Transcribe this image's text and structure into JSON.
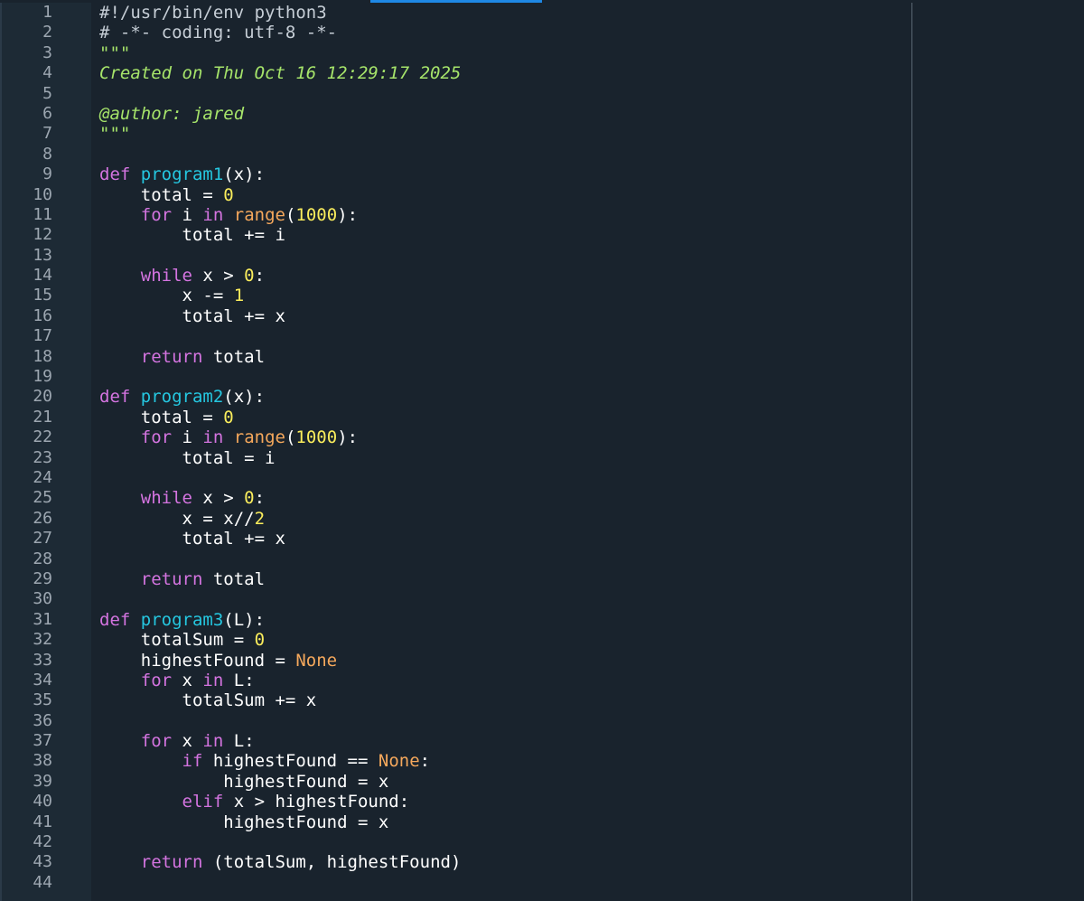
{
  "colors": {
    "background": "#19232d",
    "gutter_background": "#1d2a35",
    "line_number": "#9da7b1",
    "accent_tab": "#1e88e5",
    "ruler": "#5a6773",
    "comment": "#c6ced6",
    "docstring": "#a6e46a",
    "keyword": "#d474e0",
    "function_name": "#25c7e0",
    "number": "#faed5c",
    "builtin": "#f5a85c",
    "plain": "#ffffff"
  },
  "line_numbers": [
    "1",
    "2",
    "3",
    "4",
    "5",
    "6",
    "7",
    "8",
    "9",
    "10",
    "11",
    "12",
    "13",
    "14",
    "15",
    "16",
    "17",
    "18",
    "19",
    "20",
    "21",
    "22",
    "23",
    "24",
    "25",
    "26",
    "27",
    "28",
    "29",
    "30",
    "31",
    "32",
    "33",
    "34",
    "35",
    "36",
    "37",
    "38",
    "39",
    "40",
    "41",
    "42",
    "43",
    "44"
  ],
  "code_lines": [
    [
      {
        "t": "comment",
        "s": "#!/usr/bin/env python3"
      }
    ],
    [
      {
        "t": "comment",
        "s": "# -*- coding: utf-8 -*-"
      }
    ],
    [
      {
        "t": "doc",
        "s": "\"\"\""
      }
    ],
    [
      {
        "t": "doc",
        "s": "Created on Thu Oct 16 12:29:17 2025"
      }
    ],
    [],
    [
      {
        "t": "doc",
        "s": "@author: jared"
      }
    ],
    [
      {
        "t": "doc",
        "s": "\"\"\""
      }
    ],
    [],
    [
      {
        "t": "keyword",
        "s": "def "
      },
      {
        "t": "funcname",
        "s": "program1"
      },
      {
        "t": "plain",
        "s": "(x):"
      }
    ],
    [
      {
        "t": "plain",
        "s": "    total = "
      },
      {
        "t": "number",
        "s": "0"
      }
    ],
    [
      {
        "t": "plain",
        "s": "    "
      },
      {
        "t": "keyword",
        "s": "for"
      },
      {
        "t": "plain",
        "s": " i "
      },
      {
        "t": "keyword",
        "s": "in"
      },
      {
        "t": "plain",
        "s": " "
      },
      {
        "t": "builtin",
        "s": "range"
      },
      {
        "t": "plain",
        "s": "("
      },
      {
        "t": "number",
        "s": "1000"
      },
      {
        "t": "plain",
        "s": "):"
      }
    ],
    [
      {
        "t": "plain",
        "s": "        total += i"
      }
    ],
    [],
    [
      {
        "t": "plain",
        "s": "    "
      },
      {
        "t": "keyword",
        "s": "while"
      },
      {
        "t": "plain",
        "s": " x > "
      },
      {
        "t": "number",
        "s": "0"
      },
      {
        "t": "plain",
        "s": ":"
      }
    ],
    [
      {
        "t": "plain",
        "s": "        x -= "
      },
      {
        "t": "number",
        "s": "1"
      }
    ],
    [
      {
        "t": "plain",
        "s": "        total += x"
      }
    ],
    [],
    [
      {
        "t": "plain",
        "s": "    "
      },
      {
        "t": "keyword",
        "s": "return"
      },
      {
        "t": "plain",
        "s": " total"
      }
    ],
    [],
    [
      {
        "t": "keyword",
        "s": "def "
      },
      {
        "t": "funcname",
        "s": "program2"
      },
      {
        "t": "plain",
        "s": "(x):"
      }
    ],
    [
      {
        "t": "plain",
        "s": "    total = "
      },
      {
        "t": "number",
        "s": "0"
      }
    ],
    [
      {
        "t": "plain",
        "s": "    "
      },
      {
        "t": "keyword",
        "s": "for"
      },
      {
        "t": "plain",
        "s": " i "
      },
      {
        "t": "keyword",
        "s": "in"
      },
      {
        "t": "plain",
        "s": " "
      },
      {
        "t": "builtin",
        "s": "range"
      },
      {
        "t": "plain",
        "s": "("
      },
      {
        "t": "number",
        "s": "1000"
      },
      {
        "t": "plain",
        "s": "):"
      }
    ],
    [
      {
        "t": "plain",
        "s": "        total = i"
      }
    ],
    [],
    [
      {
        "t": "plain",
        "s": "    "
      },
      {
        "t": "keyword",
        "s": "while"
      },
      {
        "t": "plain",
        "s": " x > "
      },
      {
        "t": "number",
        "s": "0"
      },
      {
        "t": "plain",
        "s": ":"
      }
    ],
    [
      {
        "t": "plain",
        "s": "        x = x//"
      },
      {
        "t": "number",
        "s": "2"
      }
    ],
    [
      {
        "t": "plain",
        "s": "        total += x"
      }
    ],
    [],
    [
      {
        "t": "plain",
        "s": "    "
      },
      {
        "t": "keyword",
        "s": "return"
      },
      {
        "t": "plain",
        "s": " total"
      }
    ],
    [],
    [
      {
        "t": "keyword",
        "s": "def "
      },
      {
        "t": "funcname",
        "s": "program3"
      },
      {
        "t": "plain",
        "s": "(L):"
      }
    ],
    [
      {
        "t": "plain",
        "s": "    totalSum = "
      },
      {
        "t": "number",
        "s": "0"
      }
    ],
    [
      {
        "t": "plain",
        "s": "    highestFound = "
      },
      {
        "t": "const",
        "s": "None"
      }
    ],
    [
      {
        "t": "plain",
        "s": "    "
      },
      {
        "t": "keyword",
        "s": "for"
      },
      {
        "t": "plain",
        "s": " x "
      },
      {
        "t": "keyword",
        "s": "in"
      },
      {
        "t": "plain",
        "s": " L:"
      }
    ],
    [
      {
        "t": "plain",
        "s": "        totalSum += x"
      }
    ],
    [],
    [
      {
        "t": "plain",
        "s": "    "
      },
      {
        "t": "keyword",
        "s": "for"
      },
      {
        "t": "plain",
        "s": " x "
      },
      {
        "t": "keyword",
        "s": "in"
      },
      {
        "t": "plain",
        "s": " L:"
      }
    ],
    [
      {
        "t": "plain",
        "s": "        "
      },
      {
        "t": "keyword",
        "s": "if"
      },
      {
        "t": "plain",
        "s": " highestFound == "
      },
      {
        "t": "const",
        "s": "None"
      },
      {
        "t": "plain",
        "s": ":"
      }
    ],
    [
      {
        "t": "plain",
        "s": "            highestFound = x"
      }
    ],
    [
      {
        "t": "plain",
        "s": "        "
      },
      {
        "t": "keyword",
        "s": "elif"
      },
      {
        "t": "plain",
        "s": " x > highestFound:"
      }
    ],
    [
      {
        "t": "plain",
        "s": "            highestFound = x"
      }
    ],
    [],
    [
      {
        "t": "plain",
        "s": "    "
      },
      {
        "t": "keyword",
        "s": "return"
      },
      {
        "t": "plain",
        "s": " (totalSum, highestFound)"
      }
    ],
    []
  ]
}
